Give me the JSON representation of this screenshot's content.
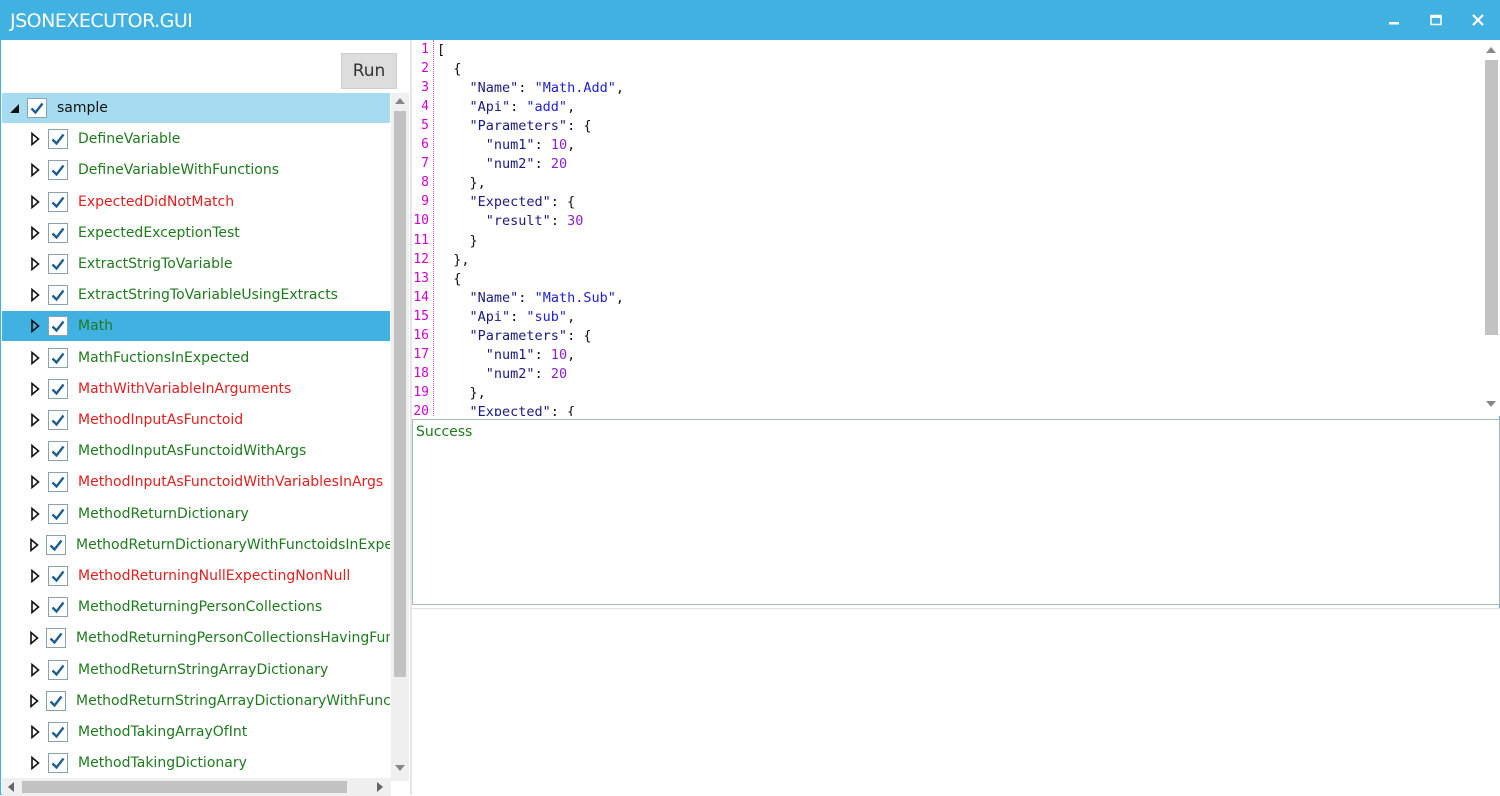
{
  "window": {
    "title": "JSONEXECUTOR.GUI",
    "accent_color": "#41b1e1",
    "controls": [
      "minimize-icon",
      "maximize-icon",
      "close-icon"
    ]
  },
  "toolbar": {
    "run_label": "Run"
  },
  "tree": {
    "root": {
      "label": "sample",
      "checked": true,
      "expanded": true
    },
    "items": [
      {
        "label": "DefineVariable",
        "status": "pass",
        "checked": true
      },
      {
        "label": "DefineVariableWithFunctions",
        "status": "pass",
        "checked": true
      },
      {
        "label": "ExpectedDidNotMatch",
        "status": "fail",
        "checked": true
      },
      {
        "label": "ExpectedExceptionTest",
        "status": "pass",
        "checked": true
      },
      {
        "label": "ExtractStrigToVariable",
        "status": "pass",
        "checked": true
      },
      {
        "label": "ExtractStringToVariableUsingExtracts",
        "status": "pass",
        "checked": true
      },
      {
        "label": "Math",
        "status": "pass",
        "checked": true,
        "selected": true
      },
      {
        "label": "MathFuctionsInExpected",
        "status": "pass",
        "checked": true
      },
      {
        "label": "MathWithVariableInArguments",
        "status": "fail",
        "checked": true
      },
      {
        "label": "MethodInputAsFunctoid",
        "status": "fail",
        "checked": true
      },
      {
        "label": "MethodInputAsFunctoidWithArgs",
        "status": "pass",
        "checked": true
      },
      {
        "label": "MethodInputAsFunctoidWithVariablesInArgs",
        "status": "fail",
        "checked": true
      },
      {
        "label": "MethodReturnDictionary",
        "status": "pass",
        "checked": true
      },
      {
        "label": "MethodReturnDictionaryWithFunctoidsInExpecte",
        "status": "pass",
        "checked": true
      },
      {
        "label": "MethodReturningNullExpectingNonNull",
        "status": "fail",
        "checked": true
      },
      {
        "label": "MethodReturningPersonCollections",
        "status": "pass",
        "checked": true
      },
      {
        "label": "MethodReturningPersonCollectionsHavingFunct",
        "status": "pass",
        "checked": true
      },
      {
        "label": "MethodReturnStringArrayDictionary",
        "status": "pass",
        "checked": true
      },
      {
        "label": "MethodReturnStringArrayDictionaryWithFunctoi",
        "status": "pass",
        "checked": true
      },
      {
        "label": "MethodTakingArrayOfInt",
        "status": "pass",
        "checked": true
      },
      {
        "label": "MethodTakingDictionary",
        "status": "pass",
        "checked": true
      }
    ],
    "status_colors": {
      "pass": "#1f7a1f",
      "fail": "#e02020"
    }
  },
  "editor": {
    "line_numbers": [
      "1",
      "2",
      "3",
      "4",
      "5",
      "6",
      "7",
      "8",
      "9",
      "10",
      "11",
      "12",
      "13",
      "14",
      "15",
      "16",
      "17",
      "18",
      "19",
      "20"
    ],
    "lines": [
      "[",
      "  {",
      "    \"Name\": \"Math.Add\",",
      "    \"Api\": \"add\",",
      "    \"Parameters\": {",
      "      \"num1\": 10,",
      "      \"num2\": 20",
      "    },",
      "    \"Expected\": {",
      "      \"result\": 30",
      "    }",
      "  },",
      "  {",
      "    \"Name\": \"Math.Sub\",",
      "    \"Api\": \"sub\",",
      "    \"Parameters\": {",
      "      \"num1\": 10,",
      "      \"num2\": 20",
      "    },",
      "    \"Expected\": {"
    ]
  },
  "output": {
    "status_text": "Success"
  }
}
